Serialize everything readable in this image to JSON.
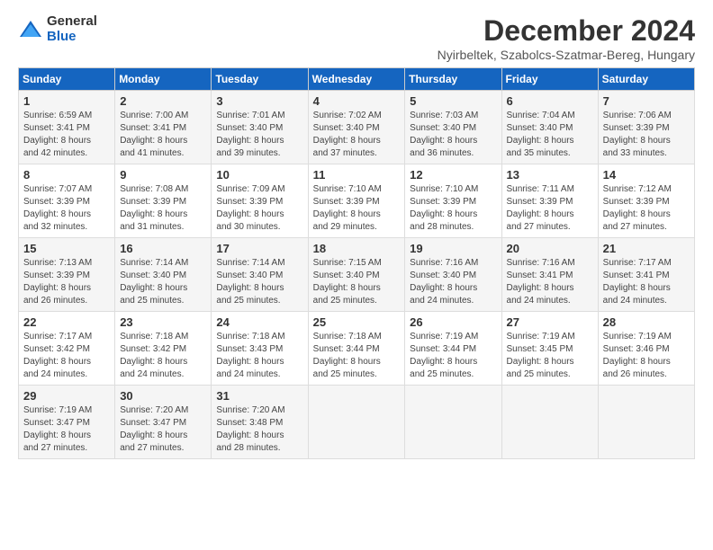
{
  "header": {
    "logo_general": "General",
    "logo_blue": "Blue",
    "main_title": "December 2024",
    "subtitle": "Nyirbeltek, Szabolcs-Szatmar-Bereg, Hungary"
  },
  "calendar": {
    "columns": [
      "Sunday",
      "Monday",
      "Tuesday",
      "Wednesday",
      "Thursday",
      "Friday",
      "Saturday"
    ],
    "weeks": [
      [
        {
          "day": "1",
          "info": "Sunrise: 6:59 AM\nSunset: 3:41 PM\nDaylight: 8 hours\nand 42 minutes."
        },
        {
          "day": "2",
          "info": "Sunrise: 7:00 AM\nSunset: 3:41 PM\nDaylight: 8 hours\nand 41 minutes."
        },
        {
          "day": "3",
          "info": "Sunrise: 7:01 AM\nSunset: 3:40 PM\nDaylight: 8 hours\nand 39 minutes."
        },
        {
          "day": "4",
          "info": "Sunrise: 7:02 AM\nSunset: 3:40 PM\nDaylight: 8 hours\nand 37 minutes."
        },
        {
          "day": "5",
          "info": "Sunrise: 7:03 AM\nSunset: 3:40 PM\nDaylight: 8 hours\nand 36 minutes."
        },
        {
          "day": "6",
          "info": "Sunrise: 7:04 AM\nSunset: 3:40 PM\nDaylight: 8 hours\nand 35 minutes."
        },
        {
          "day": "7",
          "info": "Sunrise: 7:06 AM\nSunset: 3:39 PM\nDaylight: 8 hours\nand 33 minutes."
        }
      ],
      [
        {
          "day": "8",
          "info": "Sunrise: 7:07 AM\nSunset: 3:39 PM\nDaylight: 8 hours\nand 32 minutes."
        },
        {
          "day": "9",
          "info": "Sunrise: 7:08 AM\nSunset: 3:39 PM\nDaylight: 8 hours\nand 31 minutes."
        },
        {
          "day": "10",
          "info": "Sunrise: 7:09 AM\nSunset: 3:39 PM\nDaylight: 8 hours\nand 30 minutes."
        },
        {
          "day": "11",
          "info": "Sunrise: 7:10 AM\nSunset: 3:39 PM\nDaylight: 8 hours\nand 29 minutes."
        },
        {
          "day": "12",
          "info": "Sunrise: 7:10 AM\nSunset: 3:39 PM\nDaylight: 8 hours\nand 28 minutes."
        },
        {
          "day": "13",
          "info": "Sunrise: 7:11 AM\nSunset: 3:39 PM\nDaylight: 8 hours\nand 27 minutes."
        },
        {
          "day": "14",
          "info": "Sunrise: 7:12 AM\nSunset: 3:39 PM\nDaylight: 8 hours\nand 27 minutes."
        }
      ],
      [
        {
          "day": "15",
          "info": "Sunrise: 7:13 AM\nSunset: 3:39 PM\nDaylight: 8 hours\nand 26 minutes."
        },
        {
          "day": "16",
          "info": "Sunrise: 7:14 AM\nSunset: 3:40 PM\nDaylight: 8 hours\nand 25 minutes."
        },
        {
          "day": "17",
          "info": "Sunrise: 7:14 AM\nSunset: 3:40 PM\nDaylight: 8 hours\nand 25 minutes."
        },
        {
          "day": "18",
          "info": "Sunrise: 7:15 AM\nSunset: 3:40 PM\nDaylight: 8 hours\nand 25 minutes."
        },
        {
          "day": "19",
          "info": "Sunrise: 7:16 AM\nSunset: 3:40 PM\nDaylight: 8 hours\nand 24 minutes."
        },
        {
          "day": "20",
          "info": "Sunrise: 7:16 AM\nSunset: 3:41 PM\nDaylight: 8 hours\nand 24 minutes."
        },
        {
          "day": "21",
          "info": "Sunrise: 7:17 AM\nSunset: 3:41 PM\nDaylight: 8 hours\nand 24 minutes."
        }
      ],
      [
        {
          "day": "22",
          "info": "Sunrise: 7:17 AM\nSunset: 3:42 PM\nDaylight: 8 hours\nand 24 minutes."
        },
        {
          "day": "23",
          "info": "Sunrise: 7:18 AM\nSunset: 3:42 PM\nDaylight: 8 hours\nand 24 minutes."
        },
        {
          "day": "24",
          "info": "Sunrise: 7:18 AM\nSunset: 3:43 PM\nDaylight: 8 hours\nand 24 minutes."
        },
        {
          "day": "25",
          "info": "Sunrise: 7:18 AM\nSunset: 3:44 PM\nDaylight: 8 hours\nand 25 minutes."
        },
        {
          "day": "26",
          "info": "Sunrise: 7:19 AM\nSunset: 3:44 PM\nDaylight: 8 hours\nand 25 minutes."
        },
        {
          "day": "27",
          "info": "Sunrise: 7:19 AM\nSunset: 3:45 PM\nDaylight: 8 hours\nand 25 minutes."
        },
        {
          "day": "28",
          "info": "Sunrise: 7:19 AM\nSunset: 3:46 PM\nDaylight: 8 hours\nand 26 minutes."
        }
      ],
      [
        {
          "day": "29",
          "info": "Sunrise: 7:19 AM\nSunset: 3:47 PM\nDaylight: 8 hours\nand 27 minutes."
        },
        {
          "day": "30",
          "info": "Sunrise: 7:20 AM\nSunset: 3:47 PM\nDaylight: 8 hours\nand 27 minutes."
        },
        {
          "day": "31",
          "info": "Sunrise: 7:20 AM\nSunset: 3:48 PM\nDaylight: 8 hours\nand 28 minutes."
        },
        {
          "day": "",
          "info": ""
        },
        {
          "day": "",
          "info": ""
        },
        {
          "day": "",
          "info": ""
        },
        {
          "day": "",
          "info": ""
        }
      ]
    ]
  }
}
